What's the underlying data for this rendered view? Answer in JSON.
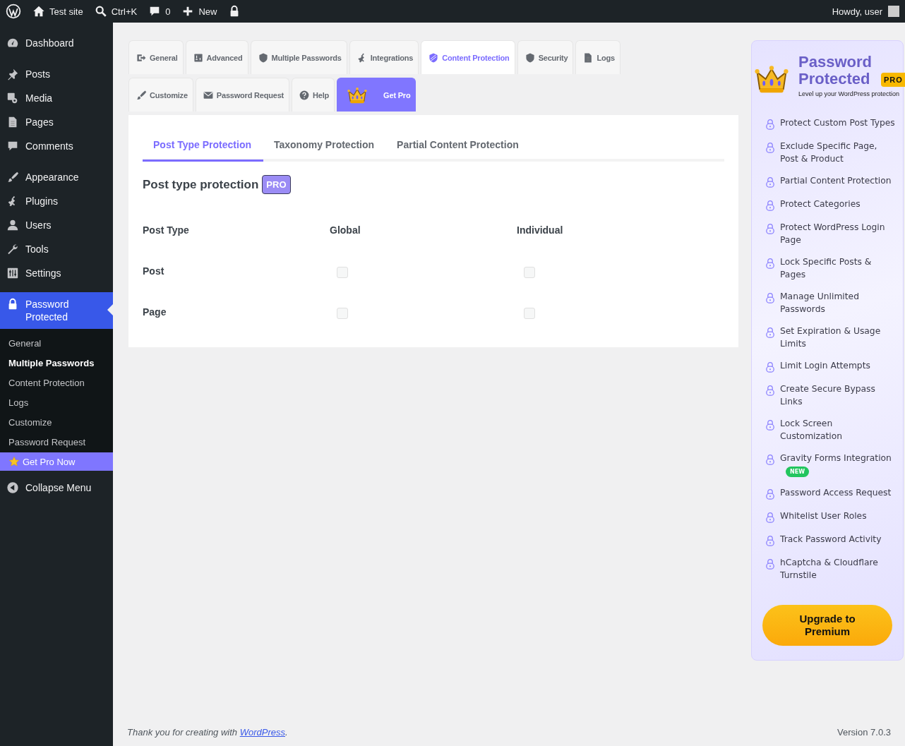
{
  "admin_bar": {
    "items": [
      {
        "label": "Test site"
      },
      {
        "label": "Ctrl+K"
      },
      {
        "label": "0"
      },
      {
        "label": "New"
      }
    ],
    "greeting": "Howdy, user"
  },
  "sidebar": {
    "groups": [
      [
        {
          "label": "Dashboard",
          "selected": false
        }
      ],
      [
        {
          "label": "Posts",
          "selected": false
        },
        {
          "label": "Media",
          "selected": false
        },
        {
          "label": "Pages",
          "selected": false
        },
        {
          "label": "Comments",
          "selected": false
        }
      ],
      [
        {
          "label": "Appearance",
          "selected": false
        },
        {
          "label": "Plugins",
          "selected": false
        },
        {
          "label": "Users",
          "selected": false
        },
        {
          "label": "Tools",
          "selected": false
        },
        {
          "label": "Settings",
          "selected": false
        }
      ],
      [
        {
          "label": "Password Protected",
          "selected": true
        }
      ]
    ],
    "submenu": [
      {
        "label": "General",
        "selected": false
      },
      {
        "label": "Multiple Passwords",
        "selected": true
      },
      {
        "label": "Content Protection",
        "selected": false
      },
      {
        "label": "Logs",
        "selected": false
      },
      {
        "label": "Customize",
        "selected": false
      },
      {
        "label": "Password Request",
        "selected": false
      }
    ],
    "pro_link": "Get Pro Now",
    "collapse": "Collapse Menu"
  },
  "tabs": [
    {
      "kind": "tab",
      "label": "General",
      "selected": false
    },
    {
      "kind": "tab",
      "label": "Advanced",
      "selected": false
    },
    {
      "kind": "tab",
      "label": "Multiple Passwords",
      "selected": false
    },
    {
      "kind": "tab",
      "label": "Integrations",
      "selected": false
    },
    {
      "kind": "tab",
      "label": "Content Protection",
      "selected": true
    },
    {
      "kind": "tab",
      "label": "Security",
      "selected": false
    },
    {
      "kind": "tab",
      "label": "Logs",
      "selected": false
    },
    {
      "kind": "tab",
      "label": "Customize",
      "selected": false
    },
    {
      "kind": "tab",
      "label": "Password Request",
      "selected": false
    },
    {
      "kind": "tab",
      "label": "Help",
      "selected": false
    },
    {
      "kind": "pro",
      "label": "Get Pro",
      "selected": false
    }
  ],
  "content": {
    "subtabs": [
      {
        "label": "Post Type Protection",
        "selected": true
      },
      {
        "label": "Taxonomy Protection",
        "selected": false
      },
      {
        "label": "Partial Content Protection",
        "selected": false
      }
    ],
    "section_title": "Post type protection",
    "section_badge": "PRO",
    "table": {
      "columns": [
        "Post Type",
        "Global",
        "Individual"
      ],
      "rows": [
        {
          "name": "Post",
          "global_checked": false,
          "individual_checked": false
        },
        {
          "name": "Page",
          "global_checked": false,
          "individual_checked": false
        }
      ]
    }
  },
  "promo": {
    "title": "Password Protected",
    "badge": "PRO",
    "tagline": "Level up your WordPress protection",
    "features": [
      {
        "label": "Protect Custom Post Types"
      },
      {
        "label": "Exclude Specific Page, Post & Product"
      },
      {
        "label": "Partial Content Protection"
      },
      {
        "label": "Protect Categories"
      },
      {
        "label": "Protect WordPress Login Page"
      },
      {
        "label": "Lock Specific Posts & Pages"
      },
      {
        "label": "Manage Unlimited Passwords"
      },
      {
        "label": "Set Expiration & Usage Limits"
      },
      {
        "label": "Limit Login Attempts"
      },
      {
        "label": "Create Secure Bypass Links"
      },
      {
        "label": "Lock Screen Customization"
      },
      {
        "label": "Gravity Forms Integration",
        "badge": "NEW"
      },
      {
        "label": "Password Access Request"
      },
      {
        "label": "Whitelist User Roles"
      },
      {
        "label": "Track Password Activity"
      },
      {
        "label": "hCaptcha & Cloudflare Turnstile"
      }
    ],
    "button": "Upgrade to Premium"
  },
  "footer": {
    "thanks_prefix": "Thank you for creating with",
    "thanks_link": "WordPress",
    "thanks_suffix": ".",
    "version": "Version 7.0.3"
  }
}
